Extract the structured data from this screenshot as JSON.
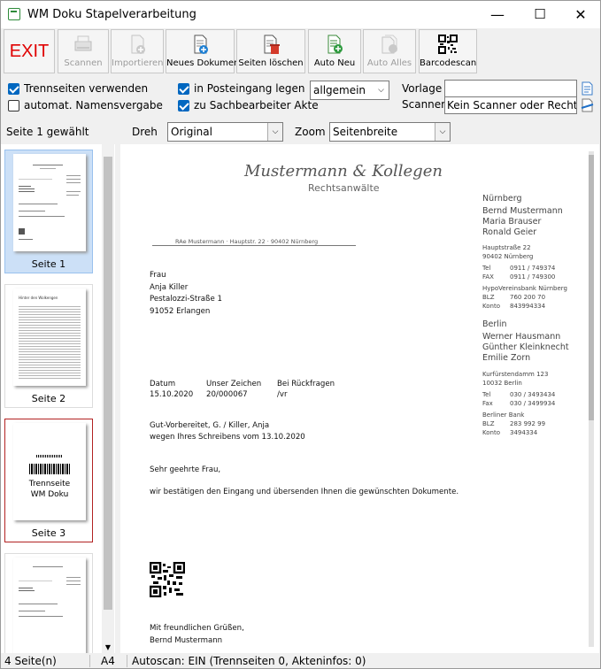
{
  "window": {
    "title": "WM Doku Stapelverarbeitung",
    "minimize": "—",
    "maximize": "☐",
    "close": "✕"
  },
  "toolbar": {
    "exit": "EXIT",
    "scan": "Scannen",
    "import": "Importieren",
    "new_doc": "Neues Dokument",
    "delete_pages": "Seiten löschen",
    "auto_new": "Auto Neu",
    "auto_all": "Auto Alles",
    "barcodescan": "Barcodescan"
  },
  "options": {
    "separator_pages": "Trennseiten verwenden",
    "auto_naming": "automat. Namensvergabe",
    "to_inbox": "in Posteingang legen",
    "to_clerk_file": "zu Sachbearbeiter Akte",
    "category": "allgemein",
    "template_label": "Vorlage",
    "template_value": "",
    "scanner_label": "Scanner",
    "scanner_value": "Kein Scanner oder Recht"
  },
  "viewbar": {
    "page_selected": "Seite 1 gewählt",
    "rotate_label": "Dreh",
    "rotate_value": "Original",
    "zoom_label": "Zoom",
    "zoom_value": "Seitenbreite"
  },
  "thumbnails": [
    {
      "label": "Seite 1"
    },
    {
      "label": "Seite 2"
    },
    {
      "label": "Seite 3",
      "sep_text_1": "Trennseite",
      "sep_text_2": "WM Doku"
    },
    {
      "label": ""
    }
  ],
  "thumb2": {
    "heading": "Hinter den Wolkengen"
  },
  "letter": {
    "firm": "Mustermann & Kollegen",
    "firm_sub": "Rechtsanwälte",
    "sender_line": "RAe Mustermann · Hauptstr. 22 · 90402 Nürnberg",
    "recipient": [
      "Frau",
      "Anja Killer",
      "Pestalozzi-Straße 1",
      "91052 Erlangen"
    ],
    "ref_heads": [
      "Datum",
      "Unser Zeichen",
      "Bei Rückfragen"
    ],
    "ref_vals": [
      "15.10.2020",
      "20/000067",
      "/vr"
    ],
    "subject_1": "Gut-Vorbereitet, G. / Killer, Anja",
    "subject_2": "wegen Ihres Schreibens vom 13.10.2020",
    "salutation": "Sehr geehrte Frau,",
    "body": "wir bestätigen den Eingang und übersenden Ihnen die gewünschten Dokumente.",
    "closing_1": "Mit freundlichen Grüßen,",
    "closing_2": "Bernd Mustermann",
    "side_city_1": "Nürnberg",
    "side_names_1": [
      "Bernd Mustermann",
      "Maria Brauser",
      "Ronald Geier"
    ],
    "side_addr_1": [
      "Hauptstraße 22",
      "90402 Nürnberg"
    ],
    "side_tel_1": [
      "Tel",
      "0911 / 749374"
    ],
    "side_fax_1": [
      "FAX",
      "0911 / 749300"
    ],
    "side_bank_1": "HypoVereinsbank Nürnberg",
    "side_blz_1": [
      "BLZ",
      "760 200 70"
    ],
    "side_kto_1": [
      "Konto",
      "843994334"
    ],
    "side_city_2": "Berlin",
    "side_names_2": [
      "Werner Hausmann",
      "Günther Kleinknecht",
      "Emilie Zorn"
    ],
    "side_addr_2": [
      "Kurfürstendamm 123",
      "10032 Berlin"
    ],
    "side_tel_2": [
      "Tel",
      "030 / 3493434"
    ],
    "side_fax_2": [
      "Fax",
      "030 / 3499934"
    ],
    "side_bank_2": "Berliner Bank",
    "side_blz_2": [
      "BLZ",
      "283 992 99"
    ],
    "side_kto_2": [
      "Konto",
      "3494334"
    ]
  },
  "status": {
    "pages": "4 Seite(n)",
    "format": "A4",
    "autoscan": "Autoscan: EIN (Trennseiten 0, Akteninfos: 0)"
  }
}
